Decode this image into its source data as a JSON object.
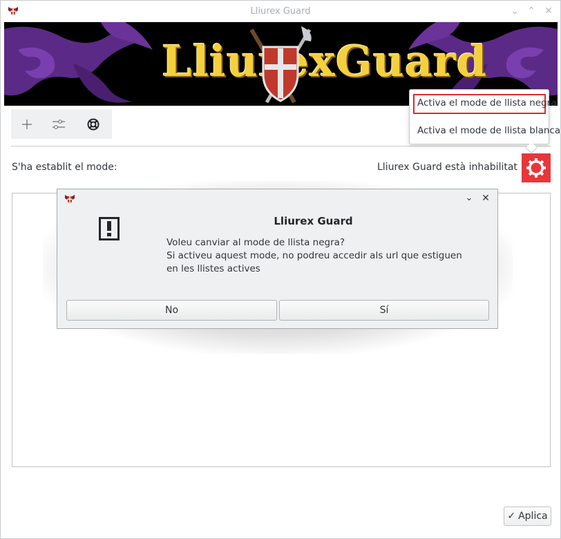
{
  "window": {
    "title": "Lliurex Guard"
  },
  "banner": {
    "title": "LliurexGuard"
  },
  "toolbar": {
    "items": [
      {
        "icon": "plus-icon"
      },
      {
        "icon": "settings-sliders-icon"
      },
      {
        "icon": "lifebuoy-icon"
      }
    ]
  },
  "status": {
    "mode_label": "S'ha establit el mode:",
    "state_text": "Lliurex Guard està inhabilitat",
    "toggle_color": "#e7373a"
  },
  "popup_menu": {
    "items": [
      {
        "label": "Activa el mode de llista negra",
        "selected": true
      },
      {
        "label": "Activa el mode de llista blanca",
        "selected": false
      }
    ]
  },
  "dialog": {
    "title": "Lliurex Guard",
    "message_line1": "Voleu canviar al mode de llista negra?",
    "message_line2": "Si activeu aquest mode, no podreu accedir als url que estiguen en les llistes actives",
    "no_label": "No",
    "yes_label": "Sí"
  },
  "footer": {
    "apply_label": "Aplica"
  }
}
